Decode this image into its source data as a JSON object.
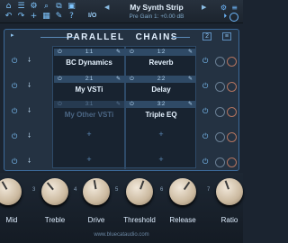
{
  "toolbar": {
    "icons": [
      "home-icon",
      "list-icon",
      "wrench-icon",
      "search-icon",
      "copy-icon",
      "save-icon",
      "undo-icon",
      "redo-icon",
      "plus-icon",
      "grid-icon",
      "edit-icon",
      "info-icon"
    ],
    "io_label": "I/O",
    "preset_name": "My Synth Strip",
    "preset_sub": "Pre Gain 1: +0.00 dB",
    "nav_prev": "◀",
    "nav_next": "▶"
  },
  "panel": {
    "title_a": "PARALLEL",
    "title_b": "CHAINS",
    "left_icon": "▸",
    "right_label_1": "2",
    "right_label_2": "≡"
  },
  "chains": [
    {
      "slots": [
        {
          "id": "1:1",
          "name": "BC Dynamics",
          "dim": false
        },
        {
          "id": "2:1",
          "name": "My VSTi",
          "dim": false
        },
        {
          "id": "3:1",
          "name": "My Other VSTi",
          "dim": true
        }
      ]
    },
    {
      "slots": [
        {
          "id": "1:2",
          "name": "Reverb",
          "dim": false
        },
        {
          "id": "2:2",
          "name": "Delay",
          "dim": false
        },
        {
          "id": "3:2",
          "name": "Triple EQ",
          "dim": false
        }
      ]
    }
  ],
  "add_symbol": "+",
  "knobs": [
    {
      "label": "Mid",
      "num": ""
    },
    {
      "label": "Treble",
      "num": "3"
    },
    {
      "label": "Drive",
      "num": "4"
    },
    {
      "label": "Threshold",
      "num": "5"
    },
    {
      "label": "Release",
      "num": "6"
    },
    {
      "label": "Ratio",
      "num": "7"
    }
  ],
  "footer": "www.bluecataudio.com",
  "colors": {
    "accent": "#6fb9ff",
    "background": "#1b2430",
    "knob": "#e6dccb"
  }
}
